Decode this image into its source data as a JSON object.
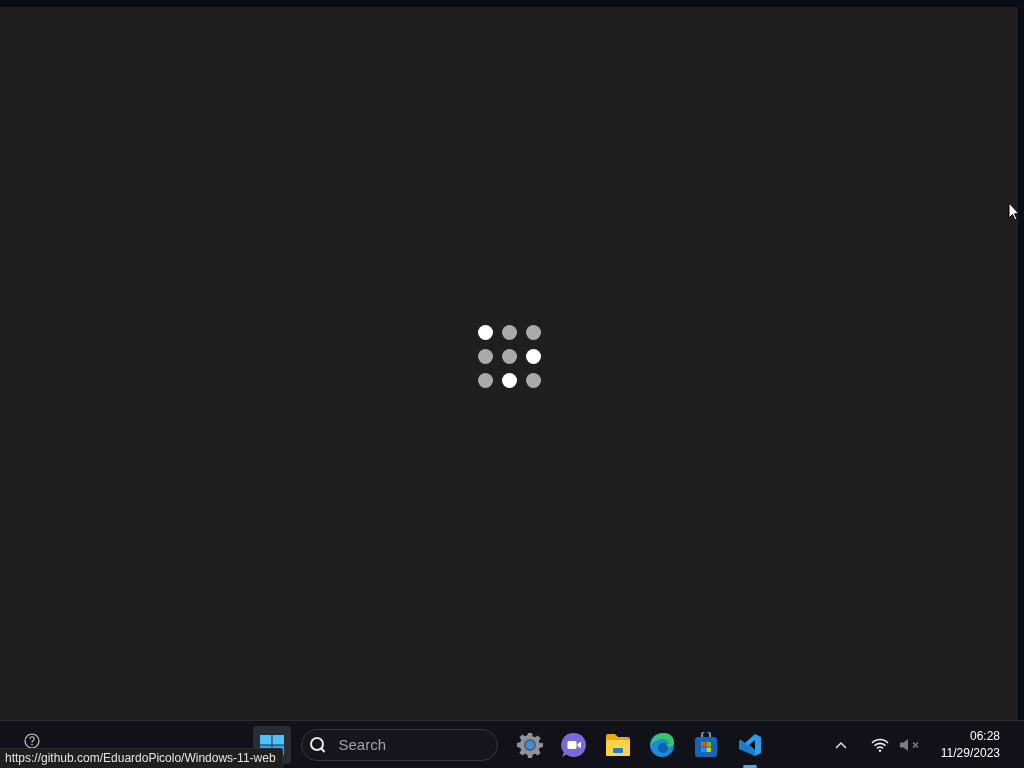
{
  "window": {
    "loading_dots": [
      {
        "lit": true
      },
      {
        "lit": false
      },
      {
        "lit": false
      },
      {
        "lit": false
      },
      {
        "lit": false
      },
      {
        "lit": true
      },
      {
        "lit": false
      },
      {
        "lit": true
      },
      {
        "lit": false
      }
    ]
  },
  "taskbar": {
    "help_button": {
      "kind": "help"
    },
    "start_button": {
      "highlighted": true
    },
    "search": {
      "placeholder": "Search"
    },
    "apps": [
      {
        "kind": "settings",
        "open": false
      },
      {
        "kind": "chat",
        "open": false
      },
      {
        "kind": "explorer",
        "open": false
      },
      {
        "kind": "edge",
        "open": false
      },
      {
        "kind": "store",
        "open": false
      },
      {
        "kind": "vscode",
        "open": true
      }
    ],
    "tray": {
      "wifi": true,
      "muted": true
    },
    "clock": {
      "time": "06:28",
      "date": "11/29/2023"
    }
  },
  "status_bar": {
    "url": "https://github.com/EduardoPicolo/Windows-11-web"
  }
}
